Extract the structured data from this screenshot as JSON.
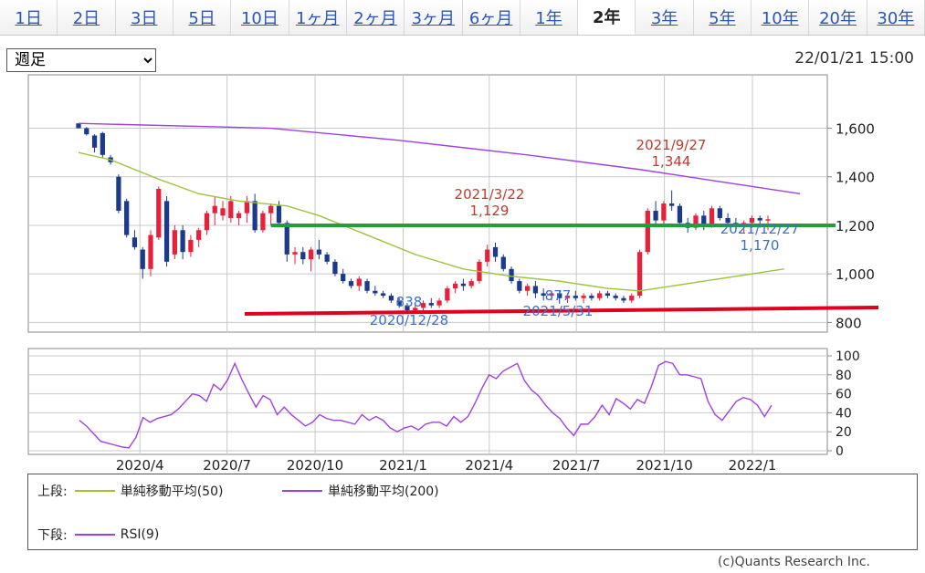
{
  "tabs": [
    {
      "label": "1日",
      "active": false
    },
    {
      "label": "2日",
      "active": false
    },
    {
      "label": "3日",
      "active": false
    },
    {
      "label": "5日",
      "active": false
    },
    {
      "label": "10日",
      "active": false
    },
    {
      "label": "1ヶ月",
      "active": false
    },
    {
      "label": "2ヶ月",
      "active": false
    },
    {
      "label": "3ヶ月",
      "active": false
    },
    {
      "label": "6ヶ月",
      "active": false
    },
    {
      "label": "1年",
      "active": false
    },
    {
      "label": "2年",
      "active": true
    },
    {
      "label": "3年",
      "active": false
    },
    {
      "label": "5年",
      "active": false
    },
    {
      "label": "10年",
      "active": false
    },
    {
      "label": "20年",
      "active": false
    },
    {
      "label": "30年",
      "active": false
    }
  ],
  "period_select": {
    "value": "週足"
  },
  "timestamp": "22/01/21 15:00",
  "legend": {
    "upper_label": "上段:",
    "sma50": "単純移動平均(50)",
    "sma200": "単純移動平均(200)",
    "lower_label": "下段:",
    "rsi": "RSI(9)"
  },
  "credit": "(c)Quants Research Inc.",
  "colors": {
    "up": "#e8213a",
    "down": "#1b3a8c",
    "sma50": "#9cc33a",
    "sma200": "#a040e0",
    "rsi": "#a040e0",
    "support": "#e00020",
    "resistance": "#1ea03a",
    "annot_red": "#c0392b",
    "annot_blue": "#3a6fd8"
  },
  "chart_data": [
    {
      "type": "candlestick",
      "x_ticks": [
        "2020/4",
        "2020/7",
        "2020/10",
        "2021/1",
        "2021/4",
        "2021/7",
        "2021/10",
        "2022/1"
      ],
      "y_ticks": [
        "1,600",
        "1,400",
        "1,200",
        "1,000",
        "800"
      ],
      "ylim": [
        760,
        1820
      ],
      "x_range": [
        "2020-01-24",
        "2022-01-21"
      ],
      "candles": [
        [
          1620,
          1620,
          1600,
          1600
        ],
        [
          1600,
          1605,
          1570,
          1575
        ],
        [
          1570,
          1575,
          1500,
          1520
        ],
        [
          1580,
          1585,
          1480,
          1490
        ],
        [
          1480,
          1490,
          1450,
          1460
        ],
        [
          1400,
          1410,
          1250,
          1260
        ],
        [
          1300,
          1310,
          1150,
          1160
        ],
        [
          1150,
          1180,
          1100,
          1110
        ],
        [
          1100,
          1110,
          980,
          1020
        ],
        [
          1020,
          1180,
          990,
          1160
        ],
        [
          1150,
          1360,
          1140,
          1350
        ],
        [
          1300,
          1320,
          1030,
          1050
        ],
        [
          1080,
          1200,
          1060,
          1180
        ],
        [
          1180,
          1200,
          1060,
          1090
        ],
        [
          1090,
          1160,
          1070,
          1140
        ],
        [
          1140,
          1190,
          1110,
          1180
        ],
        [
          1180,
          1260,
          1160,
          1250
        ],
        [
          1250,
          1320,
          1200,
          1280
        ],
        [
          1240,
          1300,
          1220,
          1270
        ],
        [
          1230,
          1320,
          1210,
          1300
        ],
        [
          1230,
          1260,
          1200,
          1250
        ],
        [
          1250,
          1320,
          1210,
          1300
        ],
        [
          1300,
          1330,
          1170,
          1180
        ],
        [
          1180,
          1260,
          1170,
          1250
        ],
        [
          1250,
          1290,
          1200,
          1280
        ],
        [
          1280,
          1300,
          1200,
          1210
        ],
        [
          1210,
          1220,
          1050,
          1080
        ],
        [
          1080,
          1110,
          1040,
          1090
        ],
        [
          1090,
          1110,
          1040,
          1060
        ],
        [
          1060,
          1110,
          1010,
          1100
        ],
        [
          1100,
          1140,
          1060,
          1080
        ],
        [
          1080,
          1090,
          1040,
          1050
        ],
        [
          1050,
          1060,
          990,
          1000
        ],
        [
          1000,
          1020,
          960,
          970
        ],
        [
          970,
          980,
          940,
          950
        ],
        [
          950,
          990,
          930,
          980
        ],
        [
          970,
          980,
          920,
          930
        ],
        [
          930,
          950,
          910,
          920
        ],
        [
          920,
          930,
          900,
          910
        ],
        [
          910,
          920,
          880,
          890
        ],
        [
          890,
          900,
          860,
          870
        ],
        [
          870,
          880,
          840,
          850
        ],
        [
          850,
          870,
          838,
          860
        ],
        [
          860,
          890,
          850,
          880
        ],
        [
          880,
          900,
          860,
          870
        ],
        [
          870,
          900,
          860,
          890
        ],
        [
          890,
          950,
          880,
          940
        ],
        [
          940,
          970,
          920,
          960
        ],
        [
          960,
          980,
          930,
          950
        ],
        [
          950,
          980,
          940,
          970
        ],
        [
          970,
          1060,
          960,
          1050
        ],
        [
          1050,
          1120,
          1030,
          1100
        ],
        [
          1110,
          1129,
          1050,
          1070
        ],
        [
          1070,
          1080,
          1010,
          1020
        ],
        [
          1020,
          1030,
          960,
          970
        ],
        [
          970,
          980,
          920,
          930
        ],
        [
          930,
          960,
          910,
          950
        ],
        [
          950,
          970,
          900,
          920
        ],
        [
          920,
          940,
          890,
          910
        ],
        [
          910,
          930,
          890,
          920
        ],
        [
          920,
          930,
          877,
          900
        ],
        [
          900,
          920,
          880,
          910
        ],
        [
          910,
          930,
          890,
          900
        ],
        [
          900,
          920,
          880,
          910
        ],
        [
          910,
          920,
          890,
          900
        ],
        [
          900,
          930,
          890,
          920
        ],
        [
          920,
          930,
          900,
          910
        ],
        [
          910,
          920,
          890,
          900
        ],
        [
          900,
          910,
          880,
          890
        ],
        [
          890,
          920,
          880,
          910
        ],
        [
          910,
          1100,
          900,
          1090
        ],
        [
          1090,
          1270,
          1080,
          1260
        ],
        [
          1260,
          1300,
          1200,
          1220
        ],
        [
          1220,
          1300,
          1200,
          1290
        ],
        [
          1290,
          1344,
          1260,
          1280
        ],
        [
          1280,
          1290,
          1200,
          1210
        ],
        [
          1210,
          1230,
          1170,
          1190
        ],
        [
          1190,
          1250,
          1180,
          1240
        ],
        [
          1240,
          1260,
          1180,
          1200
        ],
        [
          1200,
          1280,
          1190,
          1270
        ],
        [
          1270,
          1280,
          1220,
          1230
        ],
        [
          1230,
          1250,
          1200,
          1210
        ],
        [
          1210,
          1230,
          1180,
          1200
        ],
        [
          1200,
          1220,
          1170,
          1210
        ],
        [
          1210,
          1240,
          1190,
          1230
        ],
        [
          1230,
          1240,
          1190,
          1220
        ],
        [
          1220,
          1240,
          1180,
          1225
        ]
      ],
      "sma50": [
        [
          0,
          1500
        ],
        [
          4,
          1470
        ],
        [
          10,
          1390
        ],
        [
          15,
          1330
        ],
        [
          20,
          1300
        ],
        [
          26,
          1280
        ],
        [
          30,
          1240
        ],
        [
          36,
          1160
        ],
        [
          42,
          1080
        ],
        [
          48,
          1020
        ],
        [
          54,
          990
        ],
        [
          60,
          970
        ],
        [
          66,
          940
        ],
        [
          70,
          930
        ],
        [
          76,
          960
        ],
        [
          82,
          990
        ],
        [
          88,
          1020
        ]
      ],
      "sma200": [
        [
          0,
          1620
        ],
        [
          24,
          1600
        ],
        [
          40,
          1550
        ],
        [
          56,
          1490
        ],
        [
          70,
          1430
        ],
        [
          80,
          1380
        ],
        [
          90,
          1330
        ]
      ],
      "annotations": [
        {
          "label": "2021/9/27",
          "value": "1,344",
          "color": "red"
        },
        {
          "label": "2021/3/22",
          "value": "1,129",
          "color": "red"
        },
        {
          "label": "2021/12/27",
          "value": "1,170",
          "color": "blue"
        },
        {
          "label": "2020/12/28",
          "value": "838",
          "color": "blue"
        },
        {
          "label": "2021/5/31",
          "value": "877",
          "color": "blue"
        }
      ],
      "support_line": 850,
      "resistance_line": 1200
    },
    {
      "type": "line",
      "name": "RSI(9)",
      "y_ticks": [
        "100",
        "80",
        "60",
        "40",
        "20",
        "0"
      ],
      "ylim": [
        0,
        100
      ],
      "values": [
        32,
        26,
        18,
        10,
        8,
        6,
        4,
        3,
        14,
        35,
        30,
        34,
        36,
        38,
        44,
        52,
        60,
        58,
        52,
        70,
        64,
        75,
        92,
        75,
        60,
        46,
        58,
        54,
        38,
        46,
        38,
        32,
        26,
        30,
        38,
        34,
        32,
        32,
        30,
        28,
        38,
        32,
        36,
        32,
        24,
        20,
        24,
        26,
        22,
        28,
        30,
        30,
        26,
        36,
        30,
        36,
        50,
        66,
        80,
        76,
        84,
        88,
        92,
        74,
        64,
        58,
        48,
        40,
        34,
        24,
        16,
        28,
        28,
        36,
        48,
        38,
        55,
        50,
        44,
        54,
        50,
        68,
        90,
        94,
        92,
        80,
        80,
        78,
        76,
        52,
        38,
        32,
        42,
        52,
        56,
        54,
        48,
        36,
        48
      ]
    }
  ]
}
